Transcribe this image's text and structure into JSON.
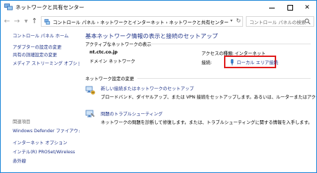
{
  "window": {
    "title": "ネットワークと共有センター",
    "minimize_glyph": "",
    "close_glyph": "✕"
  },
  "address": {
    "path": "コントロール パネル  ›  ネットワークとインターネット  ›  ネットワークと共有センター",
    "path_separator_lead": "›",
    "search_placeholder": "コントロール パネルの検索"
  },
  "sidebar": {
    "home": "コントロール パネル ホーム",
    "items": [
      "アダプターの設定の変更",
      "共有の詳細設定の変更",
      "メディア ストリーミング オプション"
    ],
    "related_label": "関連項目",
    "related": [
      "Windows Defender ファイアウォール",
      "インターネット オプション",
      "インテル(R) PROSet/Wireless",
      "赤外線"
    ]
  },
  "main": {
    "title": "基本ネットワーク情報の表示と接続のセットアップ",
    "active_header": "アクティブなネットワークの表示",
    "network_name": "nt.ctc.co.jp",
    "network_type": "ドメイン ネットワーク",
    "access_type_label": "アクセスの種類:",
    "access_type_value": "インターネット",
    "connection_label": "接続:",
    "connection_value": "ローカル エリア接続",
    "settings_header": "ネットワーク設定の変更",
    "tasks": [
      {
        "link": "新しい接続またはネットワークのセットアップ",
        "desc": "ブロードバンド、ダイヤルアップ、または VPN 接続をセットアップします。あるいは、ルーターまたはアクセス ポイントをセット"
      },
      {
        "link": "問題のトラブルシューティング",
        "desc": "ネットワークの問題を診断して修復します。または、トラブルシューティングに関する情報を入手します。"
      }
    ]
  },
  "colors": {
    "link": "#1e3287",
    "highlight_box": "#e01b1b",
    "window_border": "#1883d7"
  },
  "icons": {
    "title": "network-center-icon",
    "connection": "ethernet-icon",
    "task1": "new-connection-icon",
    "task2": "troubleshoot-icon"
  }
}
